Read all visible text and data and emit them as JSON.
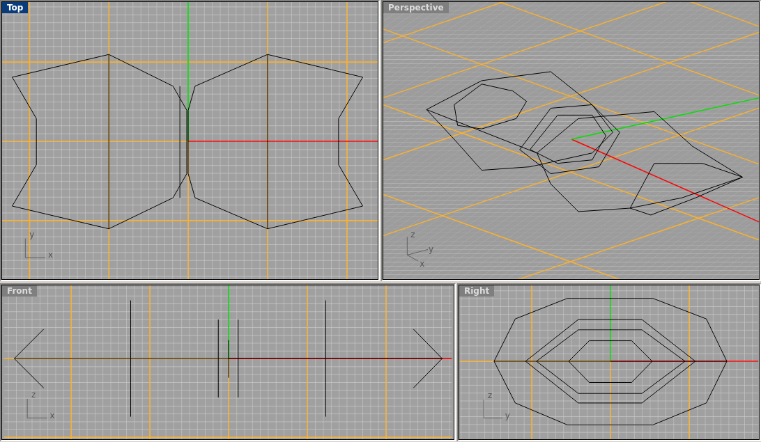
{
  "viewports": [
    {
      "kind": "top",
      "label": "Top",
      "selected": true,
      "axis_labels": [
        "y",
        "x"
      ]
    },
    {
      "kind": "perspective",
      "label": "Perspective",
      "selected": false,
      "axis_labels": [
        "z",
        "y",
        "x"
      ]
    },
    {
      "kind": "front",
      "label": "Front",
      "selected": false,
      "axis_labels": [
        "z",
        "x"
      ]
    },
    {
      "kind": "right",
      "label": "Right",
      "selected": false,
      "axis_labels": [
        "z",
        "y"
      ]
    }
  ]
}
